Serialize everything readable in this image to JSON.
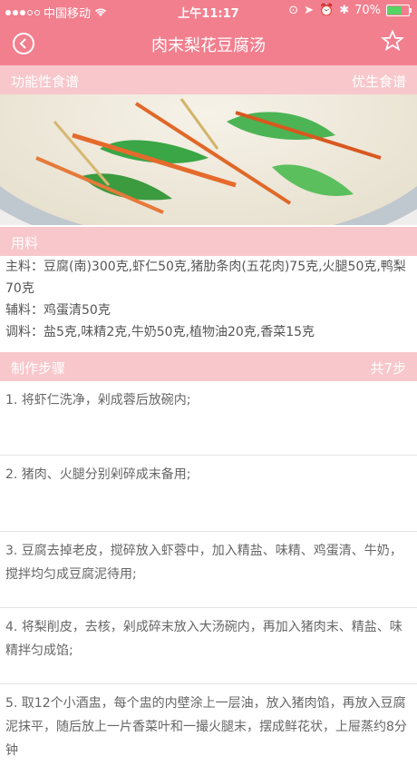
{
  "status_bar": {
    "carrier": "中国移动",
    "time": "上午11:17",
    "battery": "70%",
    "battery_level_percent": 70
  },
  "nav": {
    "title": "肉末梨花豆腐汤"
  },
  "categories": {
    "left": "功能性食谱",
    "right": "优生食谱"
  },
  "ingredients_section": {
    "header": "用料",
    "main": "主料：豆腐(南)300克,虾仁50克,猪肋条肉(五花肉)75克,火腿50克,鸭梨70克",
    "aux": "辅料：鸡蛋清50克",
    "seasoning": "调料：盐5克,味精2克,牛奶50克,植物油20克,香菜15克"
  },
  "steps_section": {
    "header": "制作步骤",
    "count": "共7步",
    "steps": [
      "1. 将虾仁洗净，剁成蓉后放碗内;",
      "2. 猪肉、火腿分别剁碎成末备用;",
      "3. 豆腐去掉老皮，搅碎放入虾蓉中，加入精盐、味精、鸡蛋清、牛奶，搅拌均匀成豆腐泥待用;",
      "4. 将梨削皮，去核，剁成碎末放入大汤碗内，再加入猪肉末、精盐、味精拌匀成馅;",
      "5. 取12个小酒盅，每个盅的内壁涂上一层油，放入猪肉馅，再放入豆腐泥抹平，随后放上一片香菜叶和一撮火腿末，摆成鲜花状，上屉蒸约8分钟"
    ]
  },
  "icons": {
    "back": "chevron-left-circle-icon",
    "favorite": "star-outline-icon",
    "wifi": "wifi-icon",
    "location": "location-arrow-icon",
    "alarm": "alarm-icon",
    "bluetooth": "bluetooth-icon",
    "battery": "battery-icon"
  },
  "colors": {
    "primary": "#f27f8e",
    "section_bg": "#f7c7cb",
    "text": "#555555"
  }
}
